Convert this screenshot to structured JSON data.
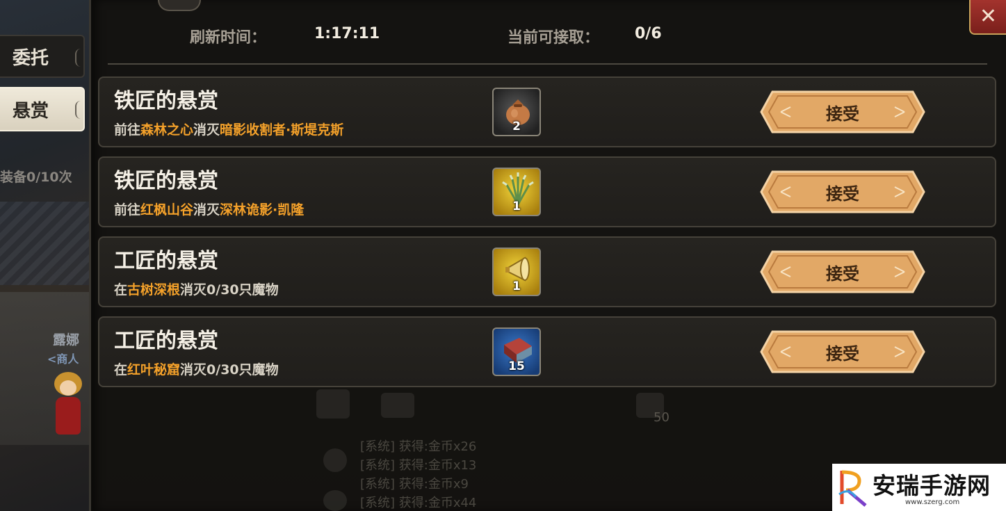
{
  "header": {
    "refresh_label": "刷新时间：",
    "refresh_value": "1:17:11",
    "available_label": "当前可接取：",
    "available_value": "0/6"
  },
  "tabs": [
    {
      "label": "委托",
      "active": false
    },
    {
      "label": "悬赏",
      "active": true
    }
  ],
  "close_icon": "close-icon",
  "background_text": {
    "equip": "装备0/10次",
    "npc_name": "露娜",
    "npc_role": "<商人",
    "level_num": "50",
    "system_logs": [
      "[系统] 获得:金币x26",
      "[系统] 获得:金币x13",
      "[系统] 获得:金币x9",
      "[系统] 获得:金币x44"
    ]
  },
  "bounties": [
    {
      "title": "铁匠的悬赏",
      "desc": [
        {
          "text": "前往",
          "hl": false
        },
        {
          "text": "森林之心",
          "hl": true
        },
        {
          "text": "消灭",
          "hl": false
        },
        {
          "text": "暗影收割者·斯堤克斯",
          "hl": true
        }
      ],
      "reward_icon": "pouch-icon",
      "reward_count": "2",
      "button": "接受"
    },
    {
      "title": "铁匠的悬赏",
      "desc": [
        {
          "text": "前往",
          "hl": false
        },
        {
          "text": "红枫山谷",
          "hl": true
        },
        {
          "text": "消灭",
          "hl": false
        },
        {
          "text": "深林诡影·凯隆",
          "hl": true
        }
      ],
      "reward_icon": "herb-icon",
      "reward_count": "1",
      "button": "接受"
    },
    {
      "title": "工匠的悬赏",
      "desc": [
        {
          "text": "在",
          "hl": false
        },
        {
          "text": "古树深根",
          "hl": true
        },
        {
          "text": "消灭0/30只魔物",
          "hl": false
        }
      ],
      "reward_icon": "horn-icon",
      "reward_count": "1",
      "button": "接受"
    },
    {
      "title": "工匠的悬赏",
      "desc": [
        {
          "text": "在",
          "hl": false
        },
        {
          "text": "红叶秘窟",
          "hl": true
        },
        {
          "text": "消灭0/30只魔物",
          "hl": false
        }
      ],
      "reward_icon": "book-icon",
      "reward_count": "15",
      "button": "接受"
    }
  ],
  "watermark": {
    "text": "安瑞手游网",
    "url": "www.szerg.com"
  },
  "colors": {
    "highlight": "#f4a12a",
    "close": "#a3332d",
    "button": "#e2a866"
  }
}
